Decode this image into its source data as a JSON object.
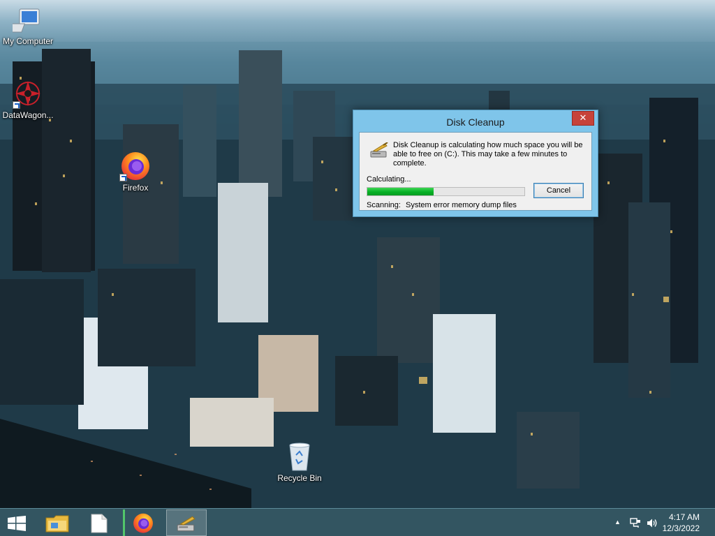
{
  "desktop": {
    "icons": [
      {
        "label": "My Computer",
        "icon": "computer-icon"
      },
      {
        "label": "DataWagon...",
        "icon": "datawagon-icon"
      },
      {
        "label": "Firefox",
        "icon": "firefox-icon"
      },
      {
        "label": "Recycle Bin",
        "icon": "recycle-bin-icon"
      }
    ]
  },
  "dialog": {
    "title": "Disk Cleanup",
    "close_glyph": "✕",
    "message": "Disk Cleanup is calculating how much space you will be able to free on  (C:). This may take a few minutes to complete.",
    "status_label": "Calculating...",
    "progress": 0.42,
    "cancel_label": "Cancel",
    "scanning_label": "Scanning:",
    "scanning_value": "System error memory dump files",
    "icon": "disk-cleanup-icon"
  },
  "taskbar": {
    "buttons": [
      {
        "name": "start-button",
        "icon": "windows-logo-icon"
      },
      {
        "name": "file-explorer-button",
        "icon": "folder-icon"
      },
      {
        "name": "blank-document-button",
        "icon": "document-icon"
      },
      {
        "name": "firefox-taskbar-button",
        "icon": "firefox-icon"
      },
      {
        "name": "disk-cleanup-taskbar-button",
        "icon": "disk-cleanup-icon"
      }
    ],
    "tray": {
      "show_hidden_glyph": "▲",
      "icons": [
        "network-icon",
        "volume-icon"
      ]
    },
    "clock": {
      "time": "4:17 AM",
      "date": "12/3/2022"
    }
  },
  "colors": {
    "accent_title": "#7fc5ea",
    "close_red": "#c7433a",
    "progress_green": "#06b025",
    "taskbar": "#345662"
  }
}
